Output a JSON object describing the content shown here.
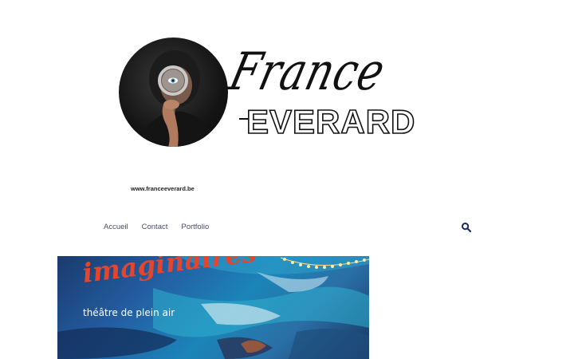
{
  "header": {
    "logo_script": "France",
    "logo_block": "EVERARD",
    "url": "www.franceeverard.be"
  },
  "nav": {
    "items": [
      {
        "label": "Accueil"
      },
      {
        "label": "Contact"
      },
      {
        "label": "Portfolio"
      }
    ],
    "search_icon": "search-icon"
  },
  "banner": {
    "title": "imaginaires",
    "subtitle": "théâtre de plein air"
  },
  "colors": {
    "nav_text": "#4a4a6a",
    "search_icon": "#1e2a5a",
    "banner_title": "#e4452c",
    "banner_subtitle": "#ffffff"
  }
}
